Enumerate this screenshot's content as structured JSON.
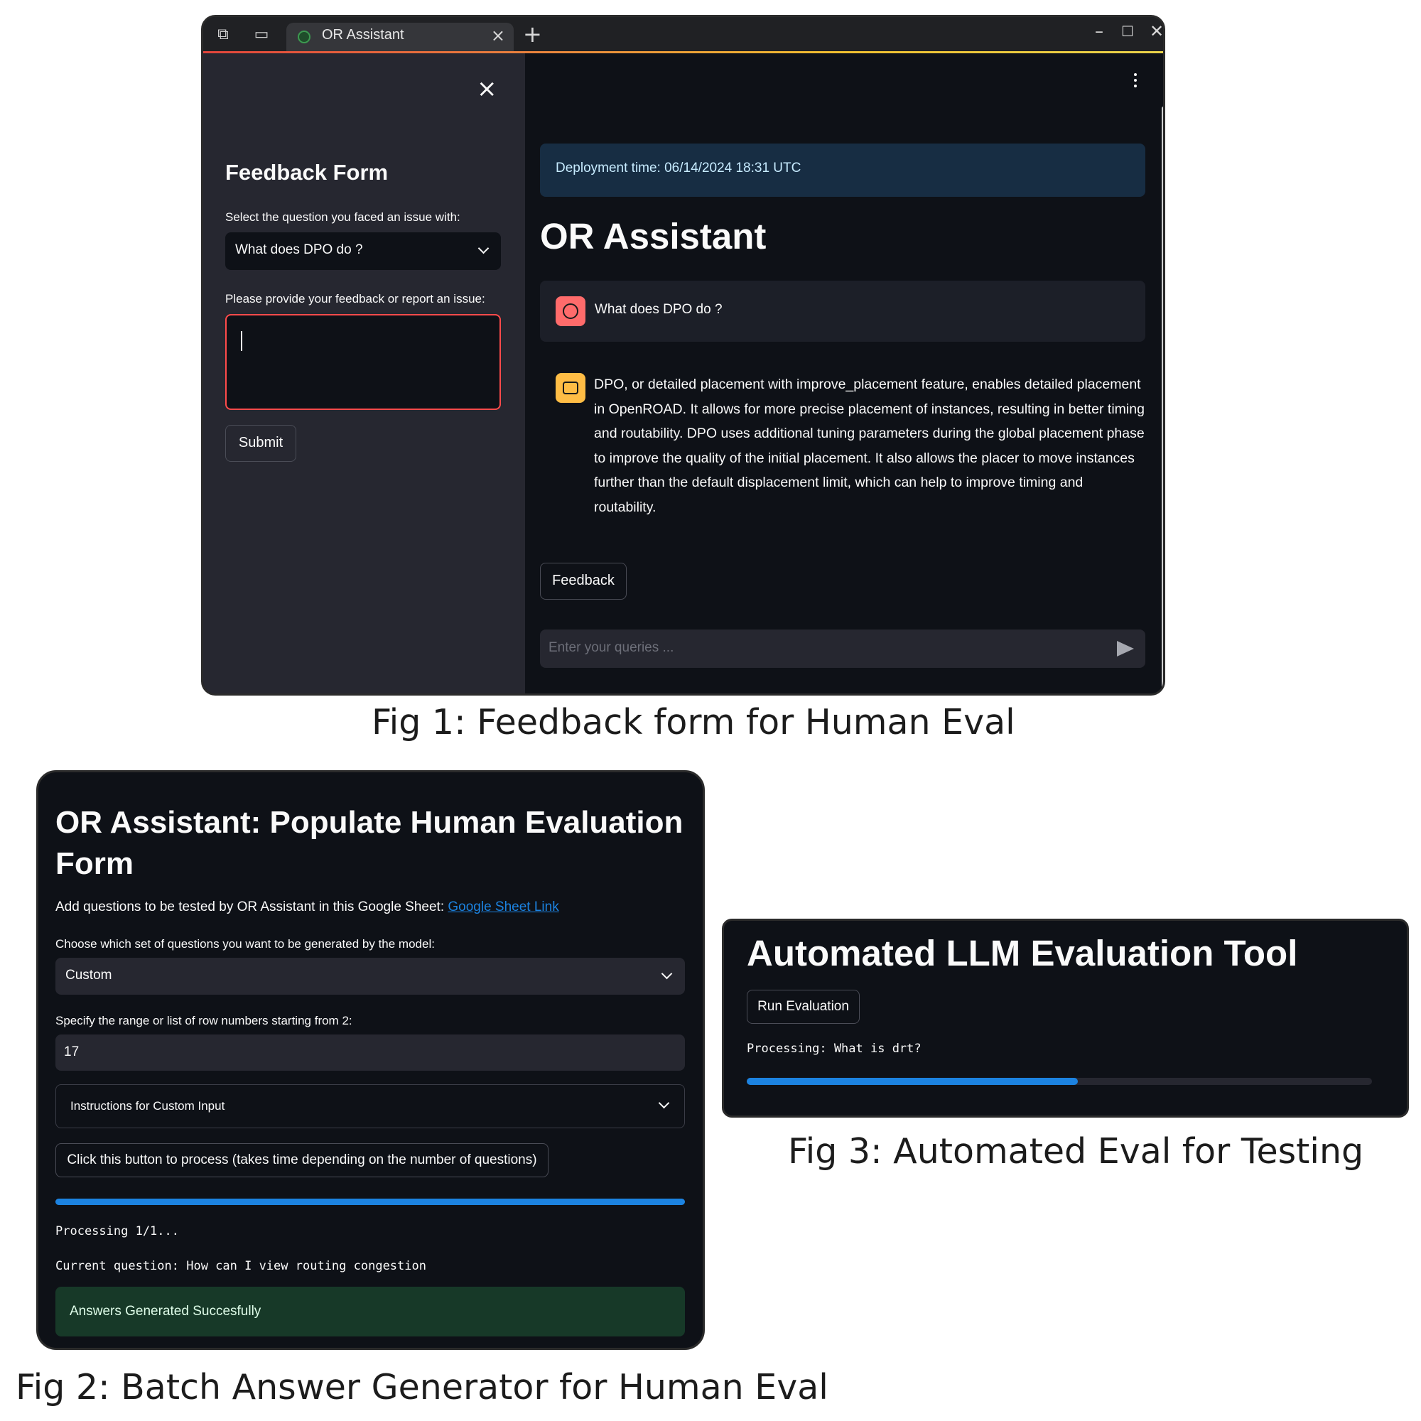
{
  "fig1": {
    "browser": {
      "tab_title": "OR Assistant"
    },
    "sidebar": {
      "title": "Feedback Form",
      "select_label": "Select the question you faced an issue with:",
      "select_value": "What does DPO do ?",
      "feedback_label": "Please provide your feedback or report an issue:",
      "feedback_value": "",
      "submit_label": "Submit"
    },
    "main": {
      "deployment_info": "Deployment time: 06/14/2024 18:31 UTC",
      "title": "OR Assistant",
      "user_message": "What does DPO do ?",
      "assistant_message": "DPO, or detailed placement with improve_placement feature, enables detailed placement in OpenROAD. It allows for more precise placement of instances, resulting in better timing and routability. DPO uses additional tuning parameters during the global placement phase to improve the quality of the initial placement. It also allows the placer to move instances further than the default displacement limit, which can help to improve timing and routability.",
      "feedback_button": "Feedback",
      "chat_placeholder": "Enter your queries ..."
    },
    "caption": "Fig 1: Feedback form for Human Eval"
  },
  "fig2": {
    "title": "OR Assistant: Populate Human Evaluation Form",
    "sheet_text": "Add questions to be tested by OR Assistant in this Google Sheet: ",
    "sheet_link": "Google Sheet Link",
    "choose_label": "Choose which set of questions you want to be generated by the model:",
    "choose_value": "Custom",
    "range_label": "Specify the range or list of row numbers starting from 2:",
    "range_value": "17",
    "expander_label": "Instructions for Custom Input",
    "process_button": "Click this button to process (takes time depending on the number of questions)",
    "progress": 1.0,
    "processing_text": "Processing 1/1...",
    "current_question": "Current question: How can I view routing congestion",
    "success_text": "Answers Generated Succesfully",
    "caption": "Fig 2: Batch Answer Generator for Human Eval"
  },
  "fig3": {
    "title": "Automated LLM Evaluation Tool",
    "run_button": "Run Evaluation",
    "processing_text": "Processing: What is drt?",
    "progress": 0.53,
    "caption": "Fig 3: Automated Eval for Testing"
  },
  "colors": {
    "accent_blue": "#1c83e1",
    "error_red": "#ff4b4b",
    "success_green": "#173928",
    "info_blue": "#172d43",
    "user_avatar": "#ff6b6b",
    "bot_avatar": "#ffbd45"
  }
}
